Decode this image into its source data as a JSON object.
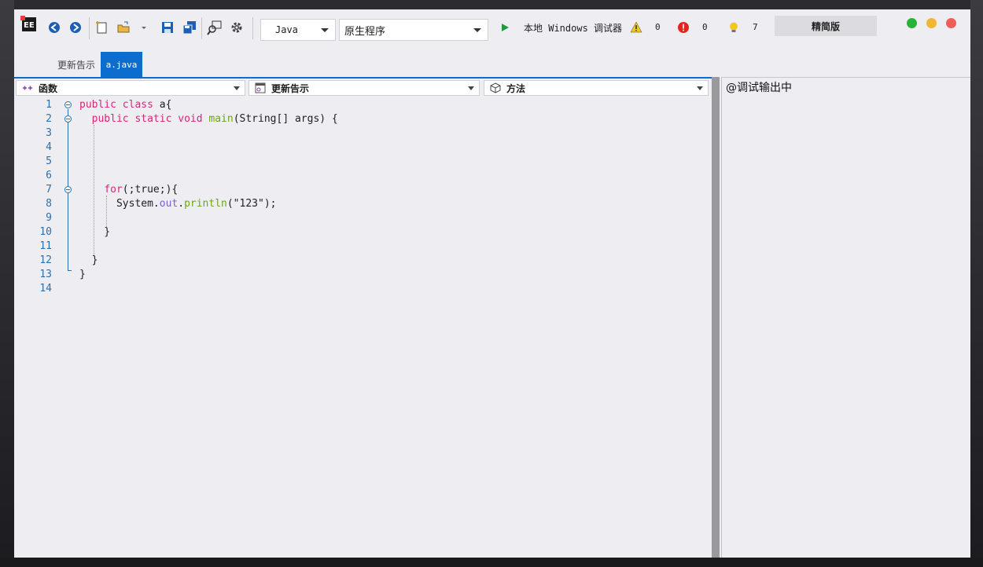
{
  "toolbar": {
    "language": "Java",
    "program_type": "原生程序",
    "debugger_label": "本地 Windows 调试器",
    "warnings_count": "0",
    "errors_count": "0",
    "hints_count": "7",
    "edition_button": "精简版",
    "colors": {
      "light_green": "#27b33a",
      "light_yellow": "#f2b632",
      "light_red": "#ee5d5a"
    }
  },
  "tabs": [
    {
      "label": "更新告示",
      "active": false
    },
    {
      "label": "a.java",
      "active": true
    }
  ],
  "navbar": {
    "functions": "函数",
    "file": "更新告示",
    "methods": "方法"
  },
  "editor": {
    "line_numbers": [
      "1",
      "2",
      "3",
      "4",
      "5",
      "6",
      "7",
      "8",
      "9",
      "10",
      "11",
      "12",
      "13",
      "14"
    ]
  },
  "output": {
    "text": "@调试输出中"
  }
}
